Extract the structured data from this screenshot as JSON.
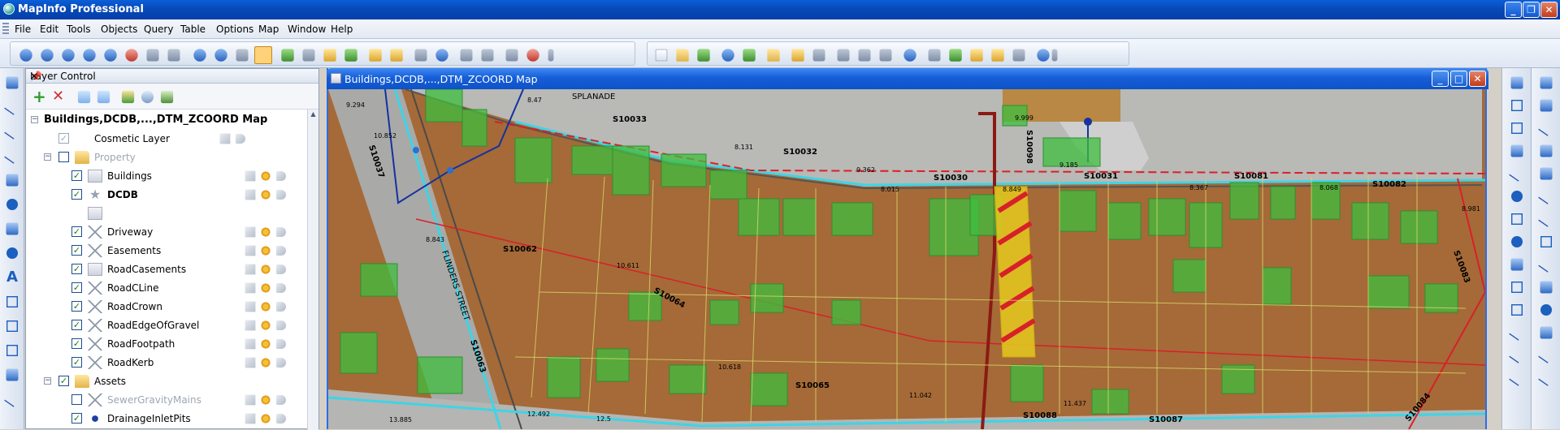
{
  "app": {
    "title": "MapInfo Professional"
  },
  "window_buttons": {
    "minimize": "_",
    "restore": "❐",
    "close": "✕"
  },
  "menu": [
    "File",
    "Edit",
    "Tools",
    "Objects",
    "Query",
    "Table",
    "Options",
    "Map",
    "Window",
    "Help"
  ],
  "toolbar": {
    "groups": [
      "selection-tools",
      "zoom-tools",
      "map-tools",
      "file-tools",
      "edit-tools",
      "table-tools"
    ],
    "active_tool": "grabber"
  },
  "layer_control": {
    "title": "Layer Control",
    "pin": "📌",
    "close": "✕",
    "map_name": "Buildings,DCDB,...,DTM_ZCOORD Map",
    "layers": [
      {
        "label": "Cosmetic Layer",
        "checked": true
      },
      {
        "label": "Property",
        "checked": false,
        "group": true
      },
      {
        "label": "Buildings",
        "checked": true
      },
      {
        "label": "DCDB",
        "checked": true
      },
      {
        "label": "Driveway",
        "checked": true
      },
      {
        "label": "Easements",
        "checked": true
      },
      {
        "label": "RoadCasements",
        "checked": true
      },
      {
        "label": "RoadCLine",
        "checked": true
      },
      {
        "label": "RoadCrown",
        "checked": true
      },
      {
        "label": "RoadEdgeOfGravel",
        "checked": true
      },
      {
        "label": "RoadFootpath",
        "checked": true
      },
      {
        "label": "RoadKerb",
        "checked": true
      },
      {
        "label": "Assets",
        "checked": true,
        "group": true
      },
      {
        "label": "SewerGravityMains",
        "checked": false
      },
      {
        "label": "DrainageInletPits",
        "checked": true
      }
    ]
  },
  "map_window": {
    "title": "Buildings,DCDB,...,DTM_ZCOORD Map",
    "street_labels": [
      "FLINDERS STREET",
      "S10037",
      "SPLANADE"
    ],
    "segment_labels": [
      "S10033",
      "S10032",
      "S10030",
      "S10031",
      "S10081",
      "S10082",
      "S10062",
      "S10064",
      "S10065",
      "S10088",
      "S10087",
      "S10083",
      "S10084",
      "S10063",
      "S10098"
    ],
    "value_labels": [
      "9.294",
      "8.47",
      "10.852",
      "8.131",
      "9.362",
      "9.185",
      "8.015",
      "8.849",
      "8.367",
      "8.068",
      "8.981",
      "9.999",
      "8.843",
      "10.611",
      "10.618",
      "11.042",
      "11.437",
      "13.885",
      "12.492",
      "12.5"
    ]
  }
}
